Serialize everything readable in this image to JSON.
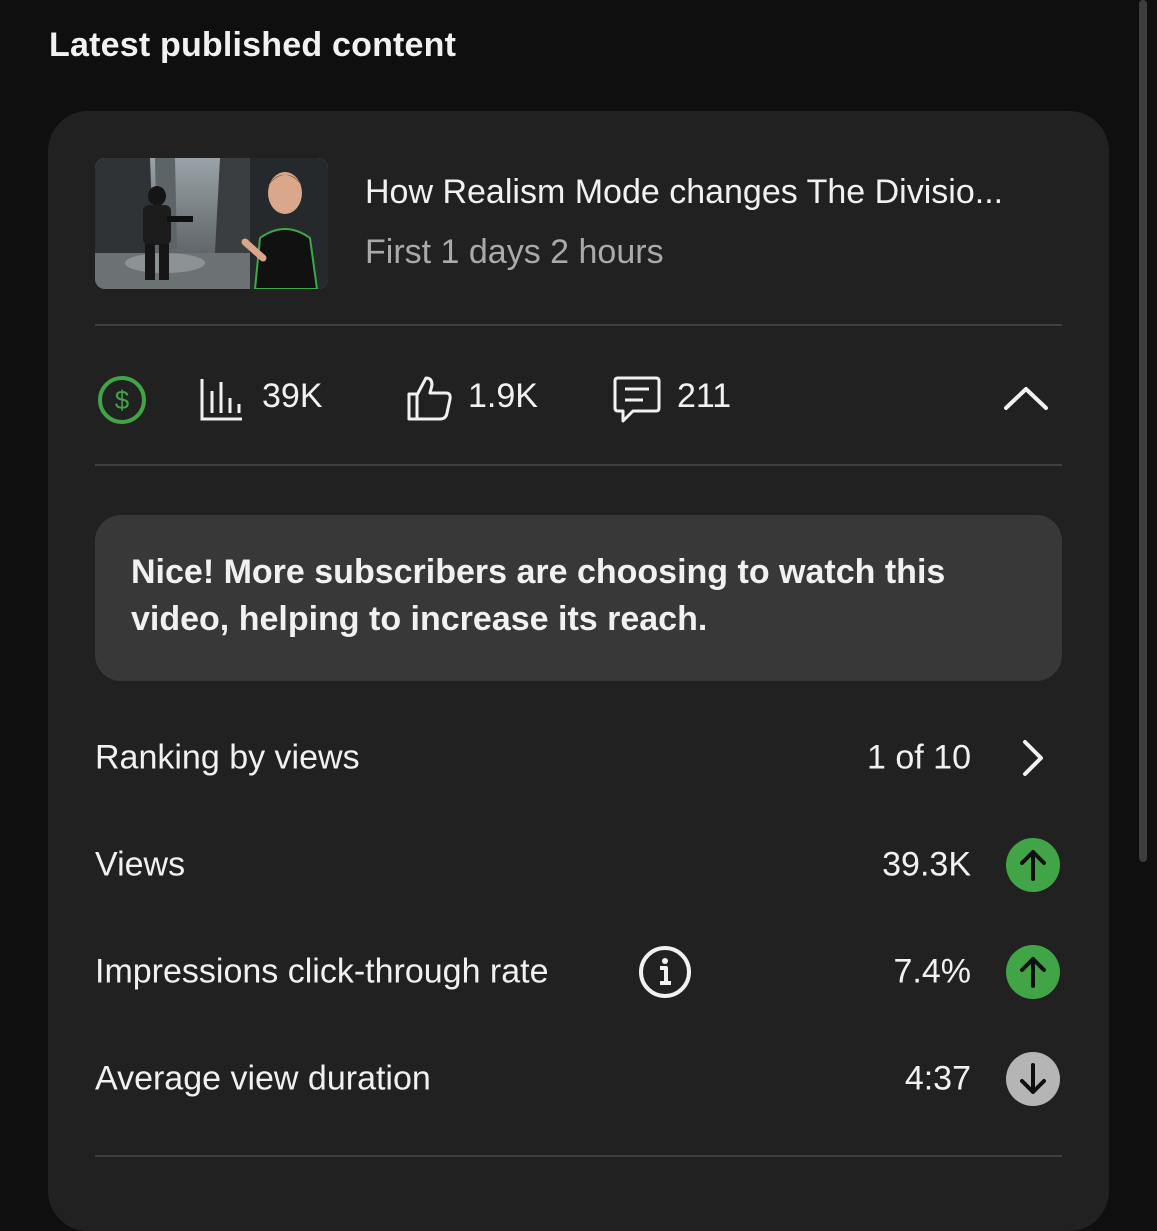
{
  "section_title": "Latest published content",
  "video": {
    "title": "How Realism Mode changes The Divisio...",
    "subtitle": "First 1 days 2 hours"
  },
  "stats": {
    "monetization_icon": "dollar-circle-icon",
    "views": "39K",
    "likes": "1.9K",
    "comments": "211"
  },
  "message": "Nice! More subscribers are choosing to watch this video, helping to increase its reach.",
  "metrics": [
    {
      "label": "Ranking by views",
      "value": "1 of 10",
      "indicator": "chevron-right"
    },
    {
      "label": "Views",
      "value": "39.3K",
      "indicator": "up",
      "indicator_color": "#41a447"
    },
    {
      "label": "Impressions click-through rate",
      "value": "7.4%",
      "indicator": "up",
      "indicator_color": "#41a447",
      "has_info": true
    },
    {
      "label": "Average view duration",
      "value": "4:37",
      "indicator": "down",
      "indicator_color": "#b5b5b5"
    }
  ],
  "colors": {
    "background": "#0f0f0f",
    "card": "#212121",
    "message_box": "#383838",
    "accent_green": "#41a447",
    "muted_text": "#aaaaaa"
  }
}
